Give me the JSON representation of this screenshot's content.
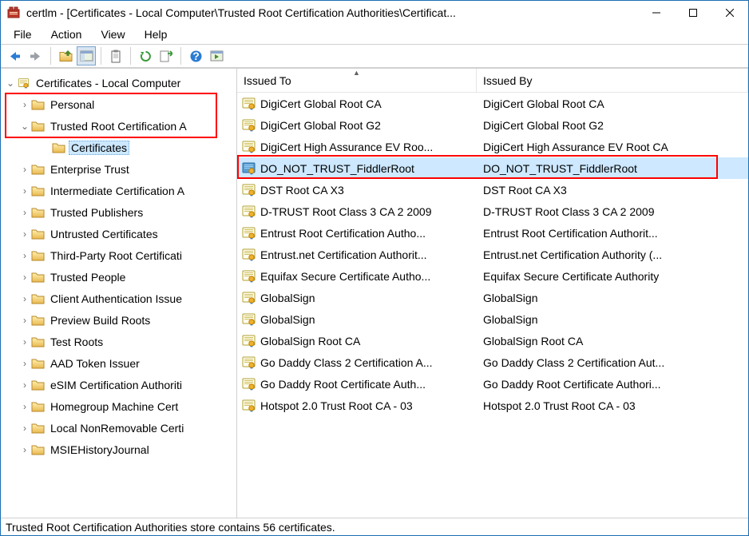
{
  "window": {
    "title": "certlm - [Certificates - Local Computer\\Trusted Root Certification Authorities\\Certificat..."
  },
  "menu": {
    "file": "File",
    "action": "Action",
    "view": "View",
    "help": "Help"
  },
  "tree": {
    "root": "Certificates - Local Computer",
    "items": [
      {
        "label": "Personal",
        "expandable": true
      },
      {
        "label": "Trusted Root Certification A",
        "expandable": true,
        "expanded": true,
        "children": [
          {
            "label": "Certificates"
          }
        ]
      },
      {
        "label": "Enterprise Trust",
        "expandable": true
      },
      {
        "label": "Intermediate Certification A",
        "expandable": true
      },
      {
        "label": "Trusted Publishers",
        "expandable": true
      },
      {
        "label": "Untrusted Certificates",
        "expandable": true
      },
      {
        "label": "Third-Party Root Certificati",
        "expandable": true
      },
      {
        "label": "Trusted People",
        "expandable": true
      },
      {
        "label": "Client Authentication Issue",
        "expandable": true
      },
      {
        "label": "Preview Build Roots",
        "expandable": true
      },
      {
        "label": "Test Roots",
        "expandable": true
      },
      {
        "label": "AAD Token Issuer",
        "expandable": true
      },
      {
        "label": "eSIM Certification Authoriti",
        "expandable": true
      },
      {
        "label": "Homegroup Machine Cert",
        "expandable": true
      },
      {
        "label": "Local NonRemovable Certi",
        "expandable": true
      },
      {
        "label": "MSIEHistoryJournal",
        "expandable": true
      }
    ]
  },
  "list": {
    "columns": [
      "Issued To",
      "Issued By"
    ],
    "rows": [
      {
        "to": "DigiCert Global Root CA",
        "by": "DigiCert Global Root CA"
      },
      {
        "to": "DigiCert Global Root G2",
        "by": "DigiCert Global Root G2"
      },
      {
        "to": "DigiCert High Assurance EV Roo...",
        "by": "DigiCert High Assurance EV Root CA"
      },
      {
        "to": "DO_NOT_TRUST_FiddlerRoot",
        "by": "DO_NOT_TRUST_FiddlerRoot",
        "selected": true,
        "special": true
      },
      {
        "to": "DST Root CA X3",
        "by": "DST Root CA X3"
      },
      {
        "to": "D-TRUST Root Class 3 CA 2 2009",
        "by": "D-TRUST Root Class 3 CA 2 2009"
      },
      {
        "to": "Entrust Root Certification Autho...",
        "by": "Entrust Root Certification Authorit..."
      },
      {
        "to": "Entrust.net Certification Authorit...",
        "by": "Entrust.net Certification Authority (..."
      },
      {
        "to": "Equifax Secure Certificate Autho...",
        "by": "Equifax Secure Certificate Authority"
      },
      {
        "to": "GlobalSign",
        "by": "GlobalSign"
      },
      {
        "to": "GlobalSign",
        "by": "GlobalSign"
      },
      {
        "to": "GlobalSign Root CA",
        "by": "GlobalSign Root CA"
      },
      {
        "to": "Go Daddy Class 2 Certification A...",
        "by": "Go Daddy Class 2 Certification Aut..."
      },
      {
        "to": "Go Daddy Root Certificate Auth...",
        "by": "Go Daddy Root Certificate Authori..."
      },
      {
        "to": "Hotspot 2.0 Trust Root CA - 03",
        "by": "Hotspot 2.0 Trust Root CA - 03"
      }
    ]
  },
  "statusbar": {
    "text": "Trusted Root Certification Authorities store contains 56 certificates."
  }
}
